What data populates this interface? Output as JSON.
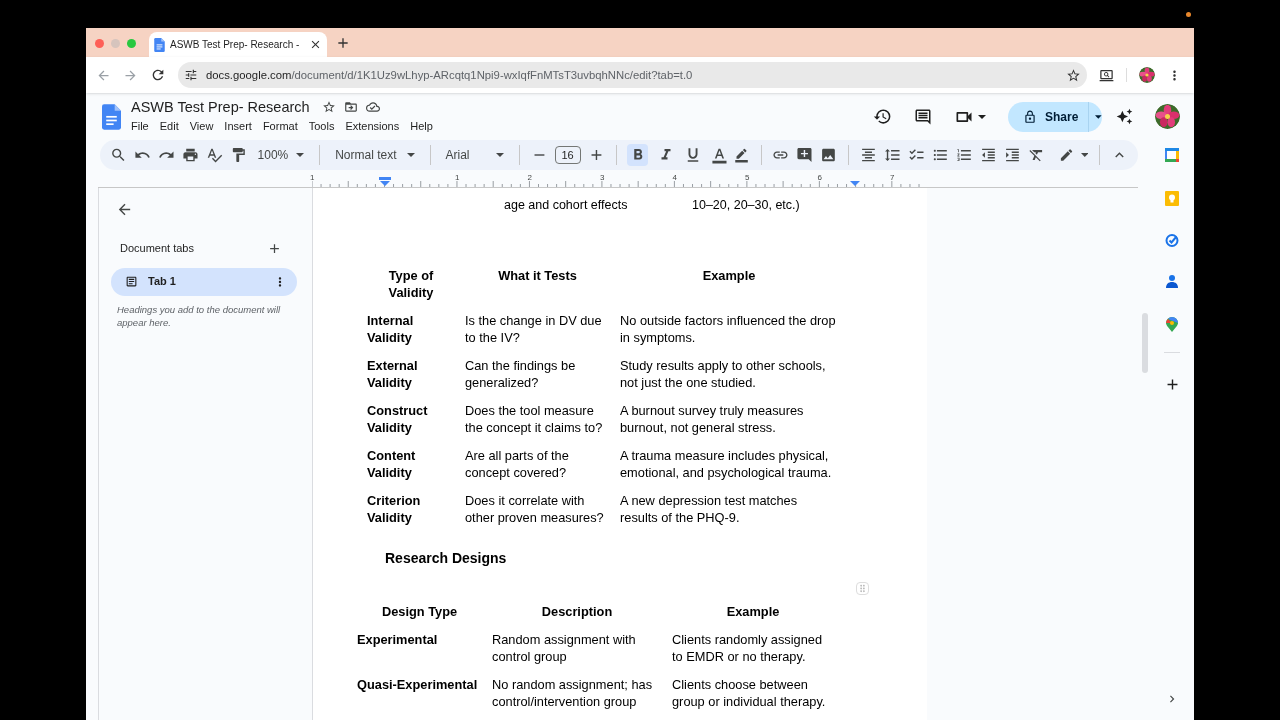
{
  "browser": {
    "tab_title": "ASWB Test Prep- Research -",
    "url_host": "docs.google.com",
    "url_path": "/document/d/1K1Uz9wLhyp-ARcqtq1Npi9-wxIqfFnMTsT3uvbqhNNc/edit?tab=t.0"
  },
  "document": {
    "title": "ASWB Test Prep- Research",
    "menu": [
      "File",
      "Edit",
      "View",
      "Insert",
      "Format",
      "Tools",
      "Extensions",
      "Help"
    ],
    "share": "Share"
  },
  "toolbar": {
    "zoom": "100%",
    "style": "Normal text",
    "font": "Arial",
    "font_size": "16",
    "bold": true,
    "italic": false,
    "underline": false
  },
  "ruler": [
    "1",
    "1",
    "2",
    "3",
    "4",
    "5",
    "6",
    "7"
  ],
  "sidebar": {
    "heading": "Document tabs",
    "tabs": [
      {
        "label": "Tab 1",
        "selected": true
      }
    ],
    "hint": "Headings you add to the document will appear here."
  },
  "page": {
    "previous_row": [
      "age and cohort effects",
      "10–20, 20–30, etc.)"
    ],
    "validity_table": {
      "columns": [
        "Type of Validity",
        "What it Tests",
        "Example"
      ],
      "rows": [
        [
          "Internal Validity",
          "Is the change in DV due to the IV?",
          "No outside factors influenced the drop in symptoms."
        ],
        [
          "External Validity",
          "Can the findings be generalized?",
          "Study results apply to other schools, not just the one studied."
        ],
        [
          "Construct Validity",
          "Does the tool measure the concept it claims to?",
          "A burnout survey truly measures burnout, not general stress."
        ],
        [
          "Content Validity",
          "Are all parts of the concept covered?",
          "A trauma measure includes physical, emotional, and psychological trauma."
        ],
        [
          "Criterion Validity",
          "Does it correlate with other proven measures?",
          "A new depression test matches results of the PHQ-9."
        ]
      ]
    },
    "heading": "Research Designs",
    "designs_table": {
      "columns": [
        "Design Type",
        "Description",
        "Example"
      ],
      "rows": [
        [
          "Experimental",
          "Random assignment with control group",
          "Clients randomly assigned to EMDR or no therapy."
        ],
        [
          "Quasi-Experimental",
          "No random assignment; has control/intervention group",
          "Clients choose between group or individual therapy."
        ]
      ]
    }
  }
}
